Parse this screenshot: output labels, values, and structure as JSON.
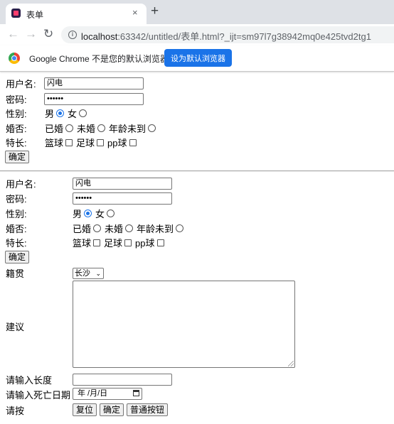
{
  "browser": {
    "tab_title": "表单",
    "tab_close": "×",
    "new_tab": "+",
    "back": "←",
    "forward": "→",
    "reload": "↻",
    "url_host": "localhost",
    "url_rest": ":63342/untitled/表单.html?_ijt=sm97l7g38942mq0e425tvd2tg1",
    "info_icon": "i",
    "infobar_text": "Google Chrome 不是您的默认浏览器",
    "infobar_button": "设为默认浏览器"
  },
  "form1": {
    "username_label": "用户名:",
    "username_value": "闪电",
    "password_label": "密码:",
    "password_value": "••••••",
    "gender_label": "性别:",
    "gender_male": "男",
    "gender_female": "女",
    "marital_label": "婚否:",
    "marital_married": "已婚",
    "marital_unmarried": "未婚",
    "marital_underage": "年龄未到",
    "skills_label": "特长:",
    "skill_basketball": "篮球",
    "skill_football": "足球",
    "skill_pingpong": "pp球",
    "submit_label": "确定"
  },
  "form2": {
    "username_label": "用户名:",
    "username_value": "闪电",
    "password_label": "密码:",
    "password_value": "••••••",
    "gender_label": "性别:",
    "gender_male": "男",
    "gender_female": "女",
    "marital_label": "婚否:",
    "marital_married": "已婚",
    "marital_unmarried": "未婚",
    "marital_underage": "年龄未到",
    "skills_label": "特长:",
    "skill_basketball": "篮球",
    "skill_football": "足球",
    "skill_pingpong": "pp球",
    "submit_label": "确定",
    "hometown_label": "籍贯",
    "hometown_value": "长沙",
    "hometown_arrow": "⌄",
    "suggestion_label": "建议",
    "length_label": "请输入长度",
    "death_date_label": "请输入死亡日期",
    "death_date_value": "年 /月/日",
    "press_label": "请按",
    "reset_label": "复位",
    "confirm_label": "确定",
    "normal_button_label": "普通按钮"
  },
  "colors": {
    "accent": "#1a73e8",
    "tabstrip": "#dee1e6",
    "omnibox": "#f1f3f4"
  },
  "icons": [
    "app-favicon-icon",
    "close-icon",
    "plus-icon",
    "back-arrow-icon",
    "forward-arrow-icon",
    "reload-icon",
    "info-icon",
    "chrome-logo-icon",
    "calendar-icon",
    "chevron-down-icon"
  ]
}
